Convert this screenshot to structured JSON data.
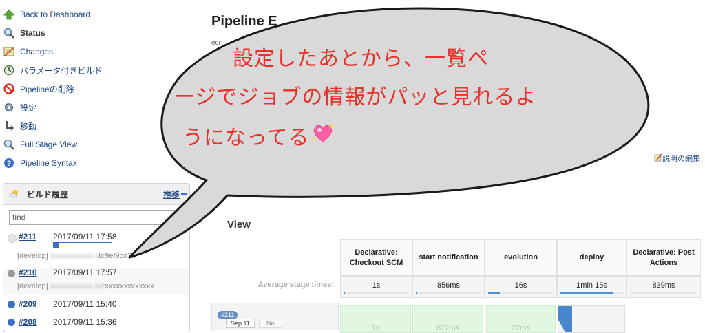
{
  "nav": {
    "items": [
      {
        "label": "Back to Dashboard",
        "icon": "up-arrow-icon"
      },
      {
        "label": "Status",
        "icon": "magnifier-icon"
      },
      {
        "label": "Changes",
        "icon": "notepad-icon"
      },
      {
        "label": "パラメータ付きビルド",
        "icon": "clock-icon"
      },
      {
        "label": "Pipelineの削除",
        "icon": "no-entry-icon"
      },
      {
        "label": "設定",
        "icon": "gear-icon"
      },
      {
        "label": "移動",
        "icon": "move-icon"
      },
      {
        "label": "Full Stage View",
        "icon": "magnifier-icon"
      },
      {
        "label": "Pipeline Syntax",
        "icon": "help-icon"
      }
    ]
  },
  "build_history": {
    "title": "ビルド履歴",
    "trend_label": "推移",
    "search_value": "find",
    "builds": [
      {
        "number": "#211",
        "date": "2017/09/11 17:58",
        "status_color": "#e0e0e0",
        "progress": 0.1,
        "branch_prefix": "[develop]",
        "branch_blur": "aaaaaaaaaa a",
        "branch_tail": "b:9ef9cd3b"
      },
      {
        "number": "#210",
        "date": "2017/09/11 17:57",
        "status_color": "#9a9a9a",
        "branch_prefix": "[develop]",
        "branch_blur": "aaaaaaaaaa aa",
        "branch_tail": ":xxxxxxxxxxxxx"
      },
      {
        "number": "#209",
        "date": "2017/09/11 15:40",
        "status_color": "#3a6fc8"
      },
      {
        "number": "#208",
        "date": "2017/09/11 15:36",
        "status_color": "#3a6fc8"
      }
    ]
  },
  "main": {
    "title": "Pipeline E",
    "subtitle": "ecr",
    "edit_description": "説明の編集",
    "stage_view_title": "View"
  },
  "stages": {
    "average_label": "Average stage times:",
    "columns": [
      {
        "name": "Declarative: Checkout SCM",
        "avg": "1s",
        "avg_fill": 0.02,
        "cell": "1s"
      },
      {
        "name": "start notification",
        "avg": "856ms",
        "avg_fill": 0.01,
        "cell": "872ms"
      },
      {
        "name": "evolution",
        "avg": "16s",
        "avg_fill": 0.18,
        "cell": "22ms"
      },
      {
        "name": "deploy",
        "avg": "1min 15s",
        "avg_fill": 0.85,
        "cell": ""
      },
      {
        "name": "Declarative: Post Actions",
        "avg": "839ms",
        "avg_fill": 0.0,
        "cell": ""
      }
    ],
    "run": {
      "badge": "#211",
      "date": "Sep 11",
      "commit": "No"
    }
  },
  "bubble": {
    "line1": "設定したあとから、一覧ペ",
    "line2": "ージでジョブの情報がパッと見れるよ",
    "line3": "うになってる",
    "emoji_icon": "sparkling-heart-icon",
    "fill": "#d9d9d9",
    "text_color": "#e8312a"
  }
}
